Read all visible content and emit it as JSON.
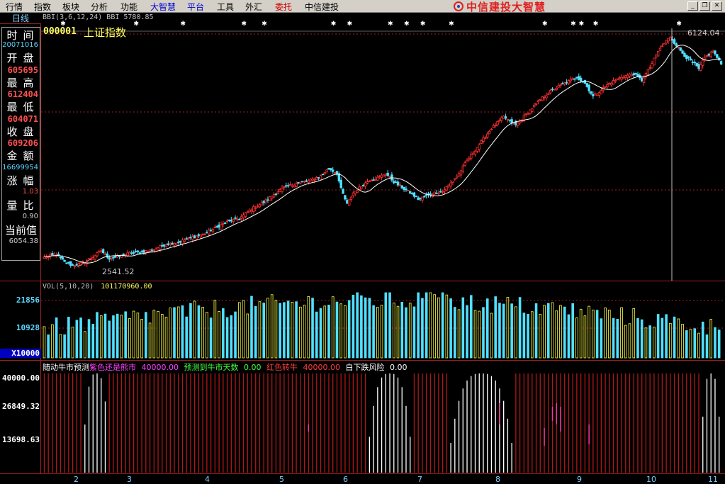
{
  "menu": {
    "items": [
      {
        "label": "行情",
        "color": "black"
      },
      {
        "label": "指数",
        "color": "black"
      },
      {
        "label": "板块",
        "color": "black"
      },
      {
        "label": "分析",
        "color": "black"
      },
      {
        "label": "功能",
        "color": "black"
      },
      {
        "label": "大智慧",
        "color": "blue"
      },
      {
        "label": "平台",
        "color": "blue"
      },
      {
        "label": "工具",
        "color": "black"
      },
      {
        "label": "外汇",
        "color": "black"
      },
      {
        "label": "委托",
        "color": "red"
      },
      {
        "label": "中信建投",
        "color": "black"
      }
    ],
    "brand": "中信建投大智慧"
  },
  "window_buttons": {
    "minimize": "_",
    "restore": "❐",
    "close": "✕"
  },
  "period_tab": "日线",
  "info": {
    "time_label": "时间",
    "time_value": "20071016",
    "open_label": "开盘",
    "open_value": "605695",
    "high_label": "最高",
    "high_value": "612404",
    "low_label": "最低",
    "low_value": "604071",
    "close_label": "收盘",
    "close_value": "609206",
    "amount_label": "金额",
    "amount_value": "16699954",
    "change_label": "涨幅",
    "change_value": "1.03",
    "volratio_label": "量比",
    "volratio_value": "0.90",
    "current_label": "当前值",
    "current_value": "6054.38"
  },
  "price_chart": {
    "indicator_text": "BBI(3,6,12,24) BBI 5780.85",
    "code": "000001",
    "name": "上证指数",
    "low_annotation": "2541.52",
    "high_annotation": "6124.04"
  },
  "volume_chart": {
    "header": "VOL(5,10,20)",
    "value": "101170960.00",
    "axis": [
      "21856",
      "10928",
      "X10000"
    ]
  },
  "indicator_chart": {
    "legend": [
      {
        "text": "随动牛市预测",
        "color": "#ffffff"
      },
      {
        "text": "紫色还是熊市",
        "color": "#ff40ff"
      },
      {
        "text": "40000.00",
        "color": "#ff40ff"
      },
      {
        "text": "预测到牛市天数",
        "color": "#40ff40"
      },
      {
        "text": "0.00",
        "color": "#40ff40"
      },
      {
        "text": "红色转牛",
        "color": "#ff4040"
      },
      {
        "text": "40000.00",
        "color": "#ff4040"
      },
      {
        "text": "白下跌风险",
        "color": "#ffffff"
      },
      {
        "text": "0.00",
        "color": "#ffffff"
      }
    ],
    "axis": [
      "40000.00",
      "26849.32",
      "13698.63"
    ]
  },
  "x_axis": [
    "2",
    "3",
    "4",
    "5",
    "6",
    "7",
    "8",
    "9",
    "10",
    "11"
  ],
  "colors": {
    "up": "#ff3030",
    "down": "#50e0ff",
    "vol_up": "#ffff40",
    "vol_down": "#50e0ff",
    "grid": "#a02020",
    "ma": "#ffffff"
  },
  "chart_data": {
    "type": "candlestick",
    "title": "上证指数",
    "annotations": [
      {
        "label": "2541.52"
      },
      {
        "label": "6124.04"
      }
    ],
    "price_anchors": [
      [
        0,
        2700
      ],
      [
        6,
        2740
      ],
      [
        10,
        2620
      ],
      [
        14,
        2570
      ],
      [
        18,
        2600
      ],
      [
        24,
        2700
      ],
      [
        28,
        2800
      ],
      [
        32,
        2680
      ],
      [
        36,
        2700
      ],
      [
        42,
        2760
      ],
      [
        48,
        2780
      ],
      [
        54,
        2820
      ],
      [
        60,
        2900
      ],
      [
        66,
        2930
      ],
      [
        72,
        3000
      ],
      [
        78,
        3050
      ],
      [
        84,
        3150
      ],
      [
        90,
        3250
      ],
      [
        96,
        3300
      ],
      [
        102,
        3450
      ],
      [
        108,
        3550
      ],
      [
        114,
        3700
      ],
      [
        118,
        3780
      ],
      [
        124,
        3850
      ],
      [
        130,
        3880
      ],
      [
        136,
        3960
      ],
      [
        140,
        4080
      ],
      [
        144,
        4000
      ],
      [
        146,
        3760
      ],
      [
        149,
        3520
      ],
      [
        152,
        3700
      ],
      [
        156,
        3800
      ],
      [
        160,
        3900
      ],
      [
        164,
        3930
      ],
      [
        168,
        4000
      ],
      [
        172,
        3870
      ],
      [
        176,
        3780
      ],
      [
        180,
        3700
      ],
      [
        184,
        3600
      ],
      [
        188,
        3650
      ],
      [
        192,
        3700
      ],
      [
        196,
        3720
      ],
      [
        200,
        3850
      ],
      [
        204,
        4000
      ],
      [
        208,
        4200
      ],
      [
        214,
        4450
      ],
      [
        220,
        4700
      ],
      [
        226,
        4880
      ],
      [
        232,
        4750
      ],
      [
        238,
        4950
      ],
      [
        244,
        5150
      ],
      [
        250,
        5300
      ],
      [
        256,
        5400
      ],
      [
        262,
        5500
      ],
      [
        266,
        5400
      ],
      [
        270,
        5200
      ],
      [
        274,
        5300
      ],
      [
        278,
        5400
      ],
      [
        284,
        5500
      ],
      [
        290,
        5550
      ],
      [
        294,
        5450
      ],
      [
        298,
        5650
      ],
      [
        302,
        5900
      ],
      [
        306,
        6060
      ],
      [
        308,
        6124
      ],
      [
        312,
        5950
      ],
      [
        316,
        5800
      ],
      [
        320,
        5700
      ],
      [
        322,
        5620
      ],
      [
        325,
        5800
      ],
      [
        329,
        5900
      ],
      [
        333,
        5700
      ]
    ],
    "bull_days": [
      [
        20,
        31
      ],
      [
        160,
        180
      ],
      [
        200,
        230
      ],
      [
        324,
        332
      ]
    ],
    "ylim": [
      2400,
      6300
    ]
  }
}
